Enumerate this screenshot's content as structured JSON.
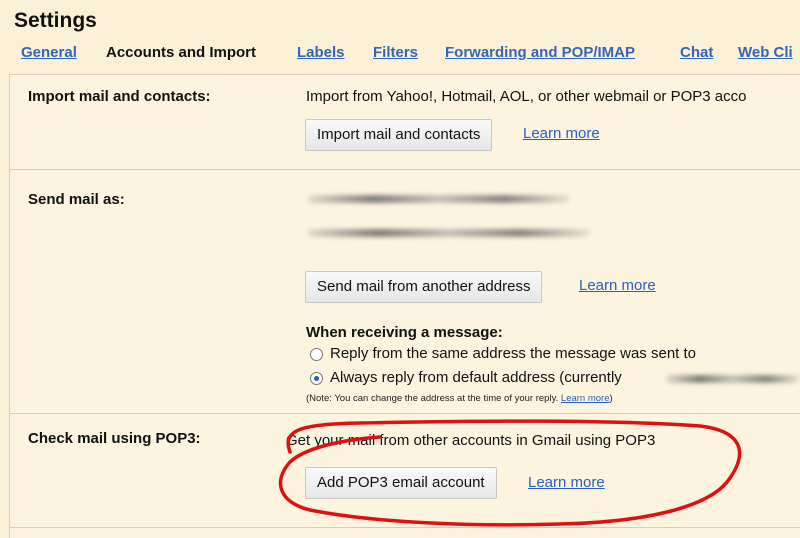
{
  "header": {
    "title": "Settings"
  },
  "tabs": [
    {
      "label": "General"
    },
    {
      "label": "Accounts and Import"
    },
    {
      "label": "Labels"
    },
    {
      "label": "Filters"
    },
    {
      "label": "Forwarding and POP/IMAP"
    },
    {
      "label": "Chat"
    },
    {
      "label": "Web Cli"
    }
  ],
  "sections": {
    "import": {
      "label": "Import mail and contacts:",
      "description": "Import from Yahoo!, Hotmail, AOL, or other webmail or POP3 acco",
      "button": "Import mail and contacts",
      "learn_more": "Learn more"
    },
    "send_as": {
      "label": "Send mail as:",
      "button": "Send mail from another address",
      "learn_more": "Learn more",
      "receiving_heading": "When receiving a message:",
      "option_same": "Reply from the same address the message was sent to",
      "option_default": "Always reply from default address (currently",
      "note": "(Note: You can change the address at the time of your reply.",
      "note_link": "Learn more",
      "note_end": ")"
    },
    "pop3": {
      "label": "Check mail using POP3:",
      "description": "Get your mail from other accounts in Gmail using POP3",
      "button": "Add POP3 email account",
      "learn_more": "Learn more"
    }
  },
  "colors": {
    "background": "#fbf1d6",
    "link": "#2a5fbd",
    "annotation": "#e01010"
  }
}
